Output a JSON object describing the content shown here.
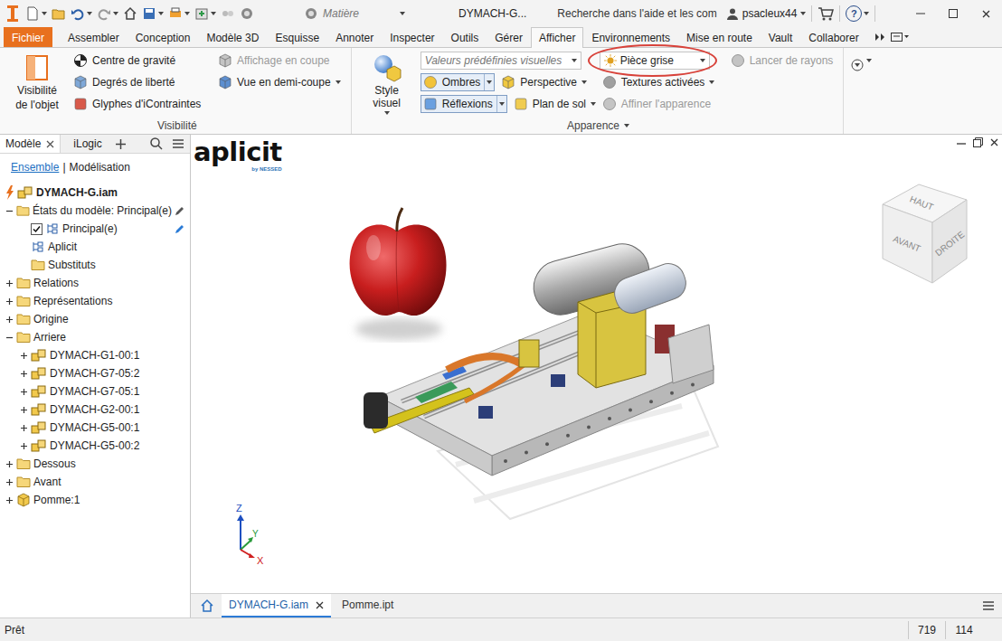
{
  "title_bar": {
    "material": "Matière",
    "document": "DYMACH-G...",
    "help_search": "Recherche dans l'aide et les com",
    "user": "psacleux44",
    "help": "?"
  },
  "ribbon_tabs": [
    {
      "label": "Fichier",
      "selected": false,
      "kind": "file"
    },
    {
      "label": "Assembler",
      "selected": false,
      "kind": "tab"
    },
    {
      "label": "Conception",
      "selected": false,
      "kind": "tab"
    },
    {
      "label": "Modèle 3D",
      "selected": false,
      "kind": "tab"
    },
    {
      "label": "Esquisse",
      "selected": false,
      "kind": "tab"
    },
    {
      "label": "Annoter",
      "selected": false,
      "kind": "tab"
    },
    {
      "label": "Inspecter",
      "selected": false,
      "kind": "tab"
    },
    {
      "label": "Outils",
      "selected": false,
      "kind": "tab"
    },
    {
      "label": "Gérer",
      "selected": false,
      "kind": "tab"
    },
    {
      "label": "Afficher",
      "selected": true,
      "kind": "tab"
    },
    {
      "label": "Environnements",
      "selected": false,
      "kind": "tab"
    },
    {
      "label": "Mise en route",
      "selected": false,
      "kind": "tab"
    },
    {
      "label": "Vault",
      "selected": false,
      "kind": "tab"
    },
    {
      "label": "Collaborer",
      "selected": false,
      "kind": "tab"
    }
  ],
  "ribbon_groups": [
    {
      "label": "Visibilité",
      "menu": false,
      "big_button": {
        "lines": [
          "Visibilité",
          "de l'objet"
        ],
        "menu": false
      },
      "columns": [
        [
          [
            {
              "kind": "button",
              "label": "Centre de gravité",
              "disabled": false,
              "menu": false
            }
          ],
          [
            {
              "kind": "button",
              "label": "Degrés de liberté",
              "disabled": false,
              "menu": false
            }
          ],
          [
            {
              "kind": "button",
              "label": "Glyphes d'iContraintes",
              "disabled": false,
              "menu": false
            }
          ]
        ],
        [
          [
            {
              "kind": "button",
              "label": "Affichage en coupe",
              "disabled": true,
              "menu": false
            }
          ],
          [
            {
              "kind": "button",
              "label": "Vue en demi-coupe",
              "disabled": false,
              "menu": true
            }
          ]
        ]
      ]
    },
    {
      "label": "Apparence",
      "menu": true,
      "big_button": {
        "lines": [
          "Style visuel"
        ],
        "menu": true
      },
      "columns": [
        [
          [
            {
              "kind": "select",
              "label": "Valeurs prédéfinies visuelles",
              "placeholder": true,
              "highlighted": false
            }
          ],
          [
            {
              "kind": "split",
              "label": "Ombres",
              "toggled": true
            },
            {
              "kind": "button",
              "label": "Perspective",
              "disabled": false,
              "menu": true
            }
          ],
          [
            {
              "kind": "split",
              "label": "Réflexions",
              "toggled": true
            },
            {
              "kind": "button",
              "label": "Plan de sol",
              "disabled": false,
              "menu": true
            }
          ]
        ],
        [
          [
            {
              "kind": "select",
              "label": "Pièce grise",
              "placeholder": false,
              "highlighted": true
            }
          ],
          [
            {
              "kind": "button",
              "label": "Textures activées",
              "disabled": false,
              "menu": true
            }
          ],
          [
            {
              "kind": "button",
              "label": "Affiner l'apparence",
              "disabled": true,
              "menu": false
            }
          ]
        ],
        [
          [
            {
              "kind": "button",
              "label": "Lancer de rayons",
              "disabled": true,
              "menu": false
            }
          ]
        ]
      ]
    }
  ],
  "browser": {
    "tabs": [
      {
        "label": "Modèle",
        "selected": true,
        "closable": true
      },
      {
        "label": "iLogic",
        "selected": false,
        "closable": false
      }
    ],
    "subtabs": [
      {
        "label": "Ensemble",
        "selected": true
      },
      {
        "label": "Modélisation",
        "selected": false
      }
    ],
    "separator": "|",
    "tree": [
      {
        "label": "DYMACH-G.iam",
        "depth": 0,
        "kind": "root",
        "expandable": false,
        "expanded": false,
        "checked": false,
        "editable": false
      },
      {
        "label": "États du modèle: Principal(e)",
        "depth": 0,
        "kind": "states",
        "expandable": true,
        "expanded": true,
        "checked": false,
        "editable": true
      },
      {
        "label": "Principal(e)",
        "depth": 1,
        "kind": "state",
        "expandable": false,
        "expanded": false,
        "checked": true,
        "editable": true
      },
      {
        "label": "Aplicit",
        "depth": 1,
        "kind": "state",
        "expandable": false,
        "expanded": false,
        "checked": false,
        "editable": false
      },
      {
        "label": "Substituts",
        "depth": 1,
        "kind": "folder",
        "expandable": false,
        "expanded": false,
        "checked": false,
        "editable": false
      },
      {
        "label": "Relations",
        "depth": 0,
        "kind": "folder",
        "expandable": true,
        "expanded": false,
        "checked": false,
        "editable": false
      },
      {
        "label": "Représentations",
        "depth": 0,
        "kind": "folder",
        "expandable": true,
        "expanded": false,
        "checked": false,
        "editable": false
      },
      {
        "label": "Origine",
        "depth": 0,
        "kind": "folder",
        "expandable": true,
        "expanded": false,
        "checked": false,
        "editable": false
      },
      {
        "label": "Arriere",
        "depth": 0,
        "kind": "folder",
        "expandable": true,
        "expanded": true,
        "checked": false,
        "editable": false
      },
      {
        "label": "DYMACH-G1-00:1",
        "depth": 1,
        "kind": "assembly",
        "expandable": true,
        "expanded": false,
        "checked": false,
        "editable": false
      },
      {
        "label": "DYMACH-G7-05:2",
        "depth": 1,
        "kind": "assembly",
        "expandable": true,
        "expanded": false,
        "checked": false,
        "editable": false
      },
      {
        "label": "DYMACH-G7-05:1",
        "depth": 1,
        "kind": "assembly",
        "expandable": true,
        "expanded": false,
        "checked": false,
        "editable": false
      },
      {
        "label": "DYMACH-G2-00:1",
        "depth": 1,
        "kind": "assembly",
        "expandable": true,
        "expanded": false,
        "checked": false,
        "editable": false
      },
      {
        "label": "DYMACH-G5-00:1",
        "depth": 1,
        "kind": "assembly",
        "expandable": true,
        "expanded": false,
        "checked": false,
        "editable": false
      },
      {
        "label": "DYMACH-G5-00:2",
        "depth": 1,
        "kind": "assembly",
        "expandable": true,
        "expanded": false,
        "checked": false,
        "editable": false
      },
      {
        "label": "Dessous",
        "depth": 0,
        "kind": "folder",
        "expandable": true,
        "expanded": false,
        "checked": false,
        "editable": false
      },
      {
        "label": "Avant",
        "depth": 0,
        "kind": "folder",
        "expandable": true,
        "expanded": false,
        "checked": false,
        "editable": false
      },
      {
        "label": "Pomme:1",
        "depth": 0,
        "kind": "part",
        "expandable": true,
        "expanded": false,
        "checked": false,
        "editable": false
      }
    ]
  },
  "viewport": {
    "logo": {
      "name": "aplicit",
      "tagline": "by NESSED"
    },
    "view_cube": [
      "HAUT",
      "AVANT",
      "DROITE"
    ],
    "axes": [
      "Z",
      "Y",
      "X"
    ]
  },
  "doc_tabs": [
    {
      "label": "DYMACH-G.iam",
      "selected": true,
      "closable": true
    },
    {
      "label": "Pomme.ipt",
      "selected": false,
      "closable": false
    }
  ],
  "status_bar": {
    "text": "Prêt",
    "counters": [
      "719",
      "114"
    ]
  }
}
